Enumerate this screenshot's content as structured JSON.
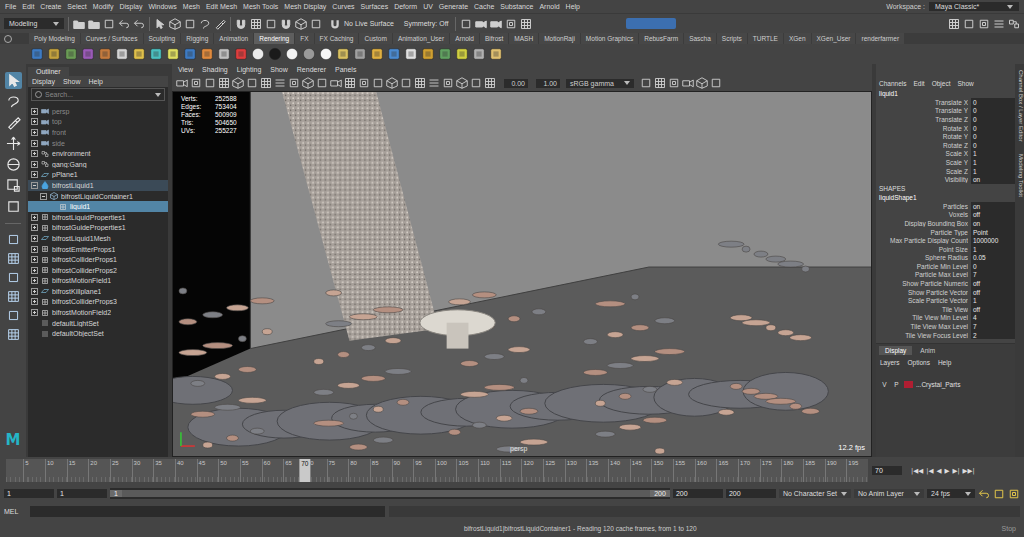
{
  "menubar": {
    "items": [
      "File",
      "Edit",
      "Create",
      "Select",
      "Modify",
      "Display",
      "Windows",
      "Mesh",
      "Edit Mesh",
      "Mesh Tools",
      "Mesh Display",
      "Curves",
      "Surfaces",
      "Deform",
      "UV",
      "Generate",
      "Cache",
      "Substance",
      "Arnold",
      "Help"
    ],
    "workspace_label": "Workspace :",
    "workspace": "Maya Classic*"
  },
  "status_line": {
    "mode": "Modeling",
    "live_surface": "No Live Surface",
    "symmetry": "Symmetry: Off"
  },
  "shelf_tabs": [
    {
      "label": "Poly Modeling",
      "selected": false
    },
    {
      "label": "Curves / Surfaces",
      "selected": false
    },
    {
      "label": "Sculpting",
      "selected": false
    },
    {
      "label": "Rigging",
      "selected": false
    },
    {
      "label": "Animation",
      "selected": false
    },
    {
      "label": "Rendering",
      "selected": true
    },
    {
      "label": "FX",
      "selected": false
    },
    {
      "label": "FX Caching",
      "selected": false
    },
    {
      "label": "Custom",
      "selected": false
    },
    {
      "label": "Animation_User",
      "selected": false
    },
    {
      "label": "Arnold",
      "selected": false
    },
    {
      "label": "Bifrost",
      "selected": false
    },
    {
      "label": "MASH",
      "selected": false
    },
    {
      "label": "MotionRaji",
      "selected": false
    },
    {
      "label": "Motion Graphics",
      "selected": false
    },
    {
      "label": "RebusFarm",
      "selected": false
    },
    {
      "label": "Sascha",
      "selected": false
    },
    {
      "label": "Scripts",
      "selected": false
    },
    {
      "label": "TURTLE",
      "selected": false
    },
    {
      "label": "XGen",
      "selected": false
    },
    {
      "label": "XGen_User",
      "selected": false
    },
    {
      "label": "renderfarmer",
      "selected": false
    }
  ],
  "logo": "M",
  "outliner": {
    "title": "Outliner",
    "menu": [
      "Display",
      "Show",
      "Help"
    ],
    "search_placeholder": "Search...",
    "items": [
      {
        "label": "persp",
        "kind": "camera",
        "depth": 0,
        "expandable": true,
        "expanded": false,
        "dimmed": true,
        "highlighted": false,
        "selected": false
      },
      {
        "label": "top",
        "kind": "camera",
        "depth": 0,
        "expandable": true,
        "expanded": false,
        "dimmed": true,
        "highlighted": false,
        "selected": false
      },
      {
        "label": "front",
        "kind": "camera",
        "depth": 0,
        "expandable": true,
        "expanded": false,
        "dimmed": true,
        "highlighted": false,
        "selected": false
      },
      {
        "label": "side",
        "kind": "camera",
        "depth": 0,
        "expandable": true,
        "expanded": false,
        "dimmed": true,
        "highlighted": false,
        "selected": false
      },
      {
        "label": "environment",
        "kind": "group",
        "depth": 0,
        "expandable": true,
        "expanded": false,
        "dimmed": false,
        "highlighted": false,
        "selected": false
      },
      {
        "label": "gang:Gang",
        "kind": "group",
        "depth": 0,
        "expandable": true,
        "expanded": false,
        "dimmed": false,
        "highlighted": false,
        "selected": false
      },
      {
        "label": "pPlane1",
        "kind": "mesh",
        "depth": 0,
        "expandable": true,
        "expanded": false,
        "dimmed": false,
        "highlighted": false,
        "selected": false
      },
      {
        "label": "bifrostLiquid1",
        "kind": "liquid",
        "depth": 0,
        "expandable": true,
        "expanded": true,
        "dimmed": false,
        "highlighted": true,
        "selected": false
      },
      {
        "label": "bifrostLiquidContainer1",
        "kind": "container",
        "depth": 1,
        "expandable": true,
        "expanded": true,
        "dimmed": false,
        "highlighted": false,
        "selected": false
      },
      {
        "label": "liquid1",
        "kind": "node",
        "depth": 2,
        "expandable": false,
        "expanded": false,
        "dimmed": false,
        "highlighted": false,
        "selected": true
      },
      {
        "label": "bifrostLiquidProperties1",
        "kind": "node",
        "depth": 0,
        "expandable": true,
        "expanded": false,
        "dimmed": false,
        "highlighted": false,
        "selected": false
      },
      {
        "label": "bifrostGuideProperties1",
        "kind": "node",
        "depth": 0,
        "expandable": true,
        "expanded": false,
        "dimmed": false,
        "highlighted": false,
        "selected": false
      },
      {
        "label": "bifrostLiquid1Mesh",
        "kind": "mesh",
        "depth": 0,
        "expandable": true,
        "expanded": false,
        "dimmed": false,
        "highlighted": false,
        "selected": false
      },
      {
        "label": "bifrostEmitterProps1",
        "kind": "node",
        "depth": 0,
        "expandable": true,
        "expanded": false,
        "dimmed": false,
        "highlighted": false,
        "selected": false
      },
      {
        "label": "bifrostColliderProps1",
        "kind": "node",
        "depth": 0,
        "expandable": true,
        "expanded": false,
        "dimmed": false,
        "highlighted": false,
        "selected": false
      },
      {
        "label": "bifrostColliderProps2",
        "kind": "node",
        "depth": 0,
        "expandable": true,
        "expanded": false,
        "dimmed": false,
        "highlighted": false,
        "selected": false
      },
      {
        "label": "bifrostMotionField1",
        "kind": "node",
        "depth": 0,
        "expandable": true,
        "expanded": false,
        "dimmed": false,
        "highlighted": false,
        "selected": false
      },
      {
        "label": "bifrostKillplane1",
        "kind": "mesh",
        "depth": 0,
        "expandable": true,
        "expanded": false,
        "dimmed": false,
        "highlighted": false,
        "selected": false
      },
      {
        "label": "bifrostColliderProps3",
        "kind": "node",
        "depth": 0,
        "expandable": true,
        "expanded": false,
        "dimmed": false,
        "highlighted": false,
        "selected": false
      },
      {
        "label": "bifrostMotionField2",
        "kind": "node",
        "depth": 0,
        "expandable": true,
        "expanded": false,
        "dimmed": false,
        "highlighted": false,
        "selected": false
      },
      {
        "label": "defaultLightSet",
        "kind": "set",
        "depth": 0,
        "expandable": false,
        "expanded": false,
        "dimmed": false,
        "highlighted": false,
        "selected": false
      },
      {
        "label": "defaultObjectSet",
        "kind": "set",
        "depth": 0,
        "expandable": false,
        "expanded": false,
        "dimmed": false,
        "highlighted": false,
        "selected": false
      }
    ]
  },
  "viewport": {
    "menu": [
      "View",
      "Shading",
      "Lighting",
      "Show",
      "Renderer",
      "Panels"
    ],
    "exposure": "0.00",
    "gamma": "1.00",
    "color_space": "sRGB gamma",
    "hud": [
      {
        "label": "Verts:",
        "value": "252588"
      },
      {
        "label": "Edges:",
        "value": "753404"
      },
      {
        "label": "Faces:",
        "value": "500909"
      },
      {
        "label": "Tris:",
        "value": "504650"
      },
      {
        "label": "UVs:",
        "value": "255227"
      }
    ],
    "camera": "persp",
    "fps": "12.2 fps"
  },
  "channel_box": {
    "menu": [
      "Channels",
      "Edit",
      "Object",
      "Show"
    ],
    "node": "liquid1",
    "attributes": [
      {
        "label": "Translate X",
        "value": "0"
      },
      {
        "label": "Translate Y",
        "value": "0"
      },
      {
        "label": "Translate Z",
        "value": "0"
      },
      {
        "label": "Rotate X",
        "value": "0"
      },
      {
        "label": "Rotate Y",
        "value": "0"
      },
      {
        "label": "Rotate Z",
        "value": "0"
      },
      {
        "label": "Scale X",
        "value": "1"
      },
      {
        "label": "Scale Y",
        "value": "1"
      },
      {
        "label": "Scale Z",
        "value": "1"
      },
      {
        "label": "Visibility",
        "value": "on"
      }
    ],
    "shapes_header": "SHAPES",
    "shape": "liquidShape1",
    "shape_attributes": [
      {
        "label": "Particles",
        "value": "on"
      },
      {
        "label": "Voxels",
        "value": "off"
      },
      {
        "label": "Display Bounding Box",
        "value": "on"
      },
      {
        "label": "Particle Type",
        "value": "Point"
      },
      {
        "label": "Max Particle Display Count",
        "value": "1000000"
      },
      {
        "label": "Point Size",
        "value": "1"
      },
      {
        "label": "Sphere Radius",
        "value": "0.05"
      },
      {
        "label": "Particle Min Level",
        "value": "0"
      },
      {
        "label": "Particle Max Level",
        "value": "7"
      },
      {
        "label": "Show Particle Numeric",
        "value": "off"
      },
      {
        "label": "Show Particle Vector",
        "value": "off"
      },
      {
        "label": "Scale Particle Vector",
        "value": "1"
      },
      {
        "label": "Tile View",
        "value": "off"
      },
      {
        "label": "Tile View Min Level",
        "value": "4"
      },
      {
        "label": "Tile View Max Level",
        "value": "7"
      },
      {
        "label": "Tile View Focus Level",
        "value": "2"
      }
    ]
  },
  "layer_editor": {
    "tabs": [
      {
        "label": "Display",
        "selected": true
      },
      {
        "label": "Anim",
        "selected": false
      }
    ],
    "menu": [
      "Layers",
      "Options",
      "Help"
    ],
    "layers": [
      {
        "visible": "V",
        "playback": "P",
        "color": "#b01e32",
        "name": "...Crystal_Parts"
      }
    ]
  },
  "side_tabs": [
    "Channel Box / Layer Editor",
    "Modeling Toolkit"
  ],
  "timeline": {
    "labels": [
      "5",
      "10",
      "15",
      "20",
      "25",
      "30",
      "35",
      "40",
      "45",
      "50",
      "55",
      "60",
      "65",
      "70",
      "75",
      "80",
      "85",
      "90",
      "95",
      "100",
      "105",
      "110",
      "115",
      "120",
      "125",
      "130",
      "135",
      "140",
      "145",
      "150",
      "155",
      "160",
      "165",
      "170",
      "175",
      "180",
      "185",
      "190",
      "195"
    ],
    "current": "70",
    "controls": [
      "|◀◀",
      "|◀",
      "◀",
      "▶",
      "▶|",
      "▶▶|"
    ]
  },
  "range": {
    "start": "1",
    "play_start": "1",
    "slider_start": "1",
    "slider_end": "200",
    "play_end": "200",
    "end": "200",
    "character_set": "No Character Set",
    "anim_layer": "No Anim Layer",
    "fps": "24 fps"
  },
  "command_line": {
    "language": "MEL"
  },
  "help_line": {
    "message": "bifrostLiquid1|bifrostLiquidContainer1 - Reading 120 cache frames, from 1 to 120",
    "stop": "Stop"
  }
}
